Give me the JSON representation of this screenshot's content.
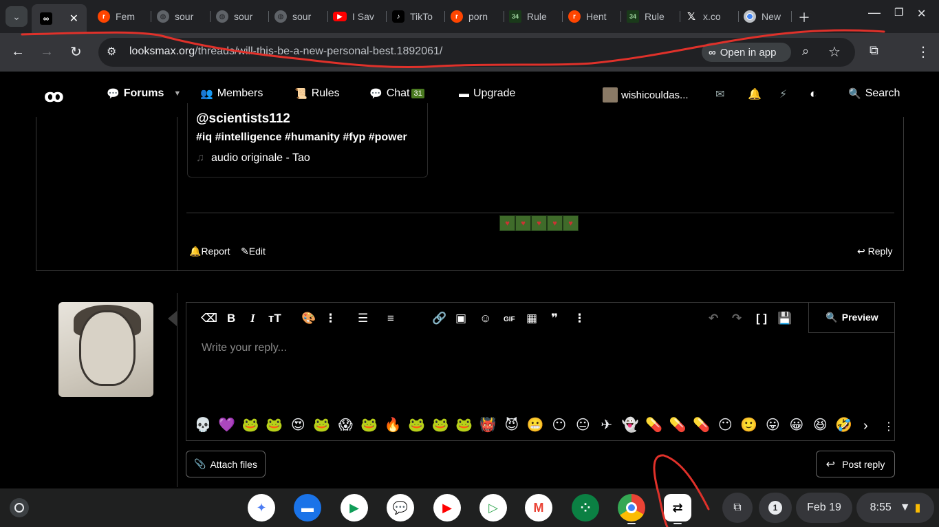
{
  "browser": {
    "tabs": [
      {
        "label": "",
        "icon": "looksmax-icon",
        "active": true
      },
      {
        "label": "Fem",
        "icon": "reddit-icon"
      },
      {
        "label": "sour",
        "icon": "globe-icon"
      },
      {
        "label": "sour",
        "icon": "globe-icon"
      },
      {
        "label": "sour",
        "icon": "globe-icon"
      },
      {
        "label": "I Sav",
        "icon": "youtube-icon"
      },
      {
        "label": "TikTo",
        "icon": "tiktok-icon"
      },
      {
        "label": "porn",
        "icon": "reddit-icon"
      },
      {
        "label": "Rule",
        "icon": "rule34-icon"
      },
      {
        "label": "Hent",
        "icon": "reddit-icon"
      },
      {
        "label": "Rule",
        "icon": "rule34-icon"
      },
      {
        "label": "x.co",
        "icon": "x-icon"
      },
      {
        "label": "New",
        "icon": "chrome-icon"
      }
    ],
    "url_host": "looksmax.org",
    "url_path": "/threads/will-this-be-a-new-personal-best.1892061/",
    "open_in_app": "Open in app"
  },
  "site": {
    "nav": {
      "forums": "Forums",
      "members": "Members",
      "rules": "Rules",
      "chat": "Chat",
      "chat_count": "31",
      "upgrade": "Upgrade",
      "username": "wishicouldas...",
      "search": "Search"
    },
    "post": {
      "handle": "@scientists112",
      "tags": "#iq #intelligence #humanity #fyp #power",
      "audio": "audio originale - Tao",
      "report": "Report",
      "edit": "Edit",
      "reply": "Reply"
    },
    "editor": {
      "placeholder": "Write your reply...",
      "preview": "Preview",
      "attach": "Attach files",
      "post_reply": "Post reply",
      "gif": "GIF"
    }
  },
  "shelf": {
    "notification_count": "1",
    "date": "Feb 19",
    "time": "8:55"
  },
  "colors": {
    "annotation": "#e0312a",
    "chat_badge": "#4a7a20"
  }
}
